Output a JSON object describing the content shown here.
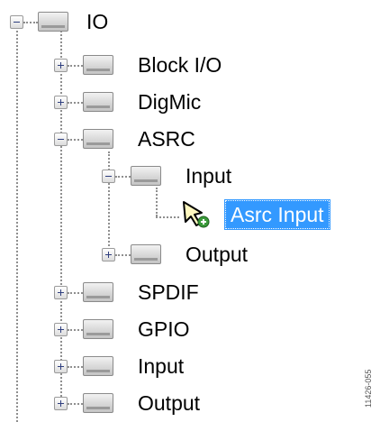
{
  "tree": {
    "root": {
      "label": "IO",
      "expanded": true
    },
    "children": [
      {
        "label": "Block I/O",
        "expanded": false
      },
      {
        "label": "DigMic",
        "expanded": false
      },
      {
        "label": "ASRC",
        "expanded": true,
        "children": [
          {
            "label": "Input",
            "expanded": true,
            "children": [
              {
                "label": "Asrc Input",
                "selected": true
              }
            ]
          },
          {
            "label": "Output",
            "expanded": false
          }
        ]
      },
      {
        "label": "SPDIF",
        "expanded": false
      },
      {
        "label": "GPIO",
        "expanded": false
      },
      {
        "label": "Input",
        "expanded": false
      },
      {
        "label": "Output",
        "expanded": false
      }
    ]
  },
  "figure_code": "11426-055",
  "colors": {
    "selection": "#3399ff",
    "connector": "#8f8f8f",
    "add_badge": "#3a9a3a"
  }
}
